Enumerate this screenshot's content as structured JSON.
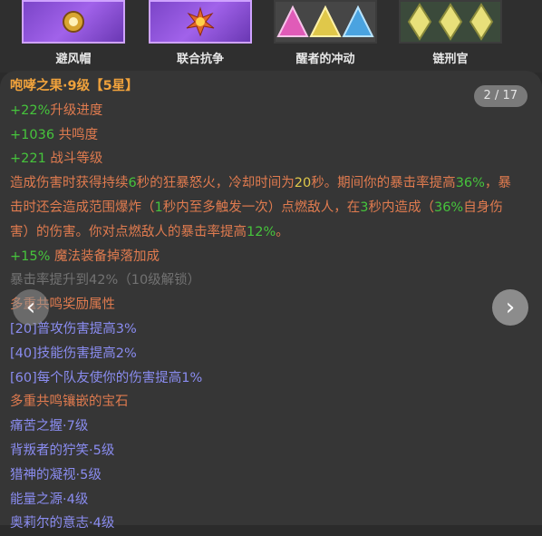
{
  "top_items": [
    {
      "label": "避风帽",
      "icon": "orb-icon"
    },
    {
      "label": "联合抗争",
      "icon": "explosion-icon"
    },
    {
      "label": "醒者的冲动",
      "icon": "triangle-gems-icon"
    },
    {
      "label": "链刑官",
      "icon": "crystal-gems-icon"
    }
  ],
  "card": {
    "page_indicator": "2 / 17",
    "title_line": "咆哮之果·9级【5星】",
    "stats": [
      {
        "value": "+22%",
        "label": "升级进度"
      },
      {
        "value": "+1036",
        "label": " 共鸣度"
      },
      {
        "value": "+221",
        "label": " 战斗等级"
      }
    ],
    "description": [
      {
        "t": "造成伤害时获得持续",
        "c": "orange"
      },
      {
        "t": "6",
        "c": "green"
      },
      {
        "t": "秒的狂暴怒火，冷却时间为",
        "c": "orange"
      },
      {
        "t": "20",
        "c": "yellow"
      },
      {
        "t": "秒。期间你的暴击率提高",
        "c": "orange"
      },
      {
        "t": "36%",
        "c": "green"
      },
      {
        "t": "，暴击时还会造成范围爆炸（",
        "c": "orange"
      },
      {
        "t": "1",
        "c": "green"
      },
      {
        "t": "秒内至多触发一次）点燃敌人，在",
        "c": "orange"
      },
      {
        "t": "3",
        "c": "green"
      },
      {
        "t": "秒内造成（",
        "c": "orange"
      },
      {
        "t": "36%",
        "c": "green"
      },
      {
        "t": "自身伤害）的伤害。你对点燃敌人的暴击率提高",
        "c": "orange"
      },
      {
        "t": "12%",
        "c": "green"
      },
      {
        "t": "。",
        "c": "orange"
      }
    ],
    "magic_bonus": {
      "value": "+15%",
      "label": " 魔法装备掉落加成"
    },
    "locked_text": "暴击率提升到42%（10级解锁）",
    "resonance_header": "多重共鸣奖励属性",
    "resonance_bonuses": [
      "[20]普攻伤害提高3%",
      "[40]技能伤害提高2%",
      "[60]每个队友使你的伤害提高1%"
    ],
    "gems_header": "多重共鸣镶嵌的宝石",
    "gems": [
      "痛苦之握·7级",
      "背叛者的狞笑·5级",
      "猎神的凝视·5级",
      "能量之源·4级",
      "奥莉尔的意志·4级"
    ],
    "nav_prev": "‹",
    "nav_next": "›"
  }
}
